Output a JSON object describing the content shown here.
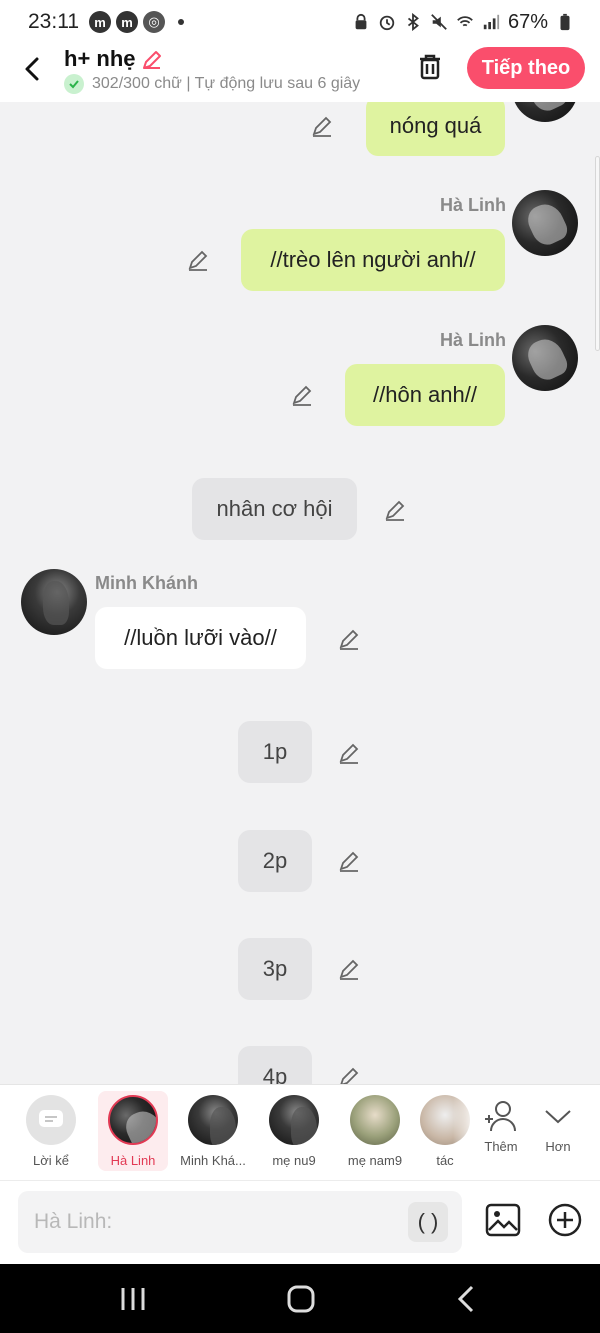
{
  "status": {
    "time": "23:11",
    "battery": "67%"
  },
  "header": {
    "title": "h+ nhẹ",
    "subtitle": "302/300 chữ | Tự động lưu sau 6 giây",
    "next_label": "Tiếp theo"
  },
  "messages": [
    {
      "text": "nóng quá"
    },
    {
      "speaker": "Hà Linh",
      "text": "//trèo lên người anh//"
    },
    {
      "speaker": "Hà Linh",
      "text": "//hôn anh//"
    },
    {
      "text": "nhân cơ hội"
    },
    {
      "speaker": "Minh Khánh",
      "text": "//luồn lưỡi vào//"
    },
    {
      "text": "1p"
    },
    {
      "text": "2p"
    },
    {
      "text": "3p"
    },
    {
      "text": "4p"
    }
  ],
  "characters": [
    {
      "label": "Lời kể",
      "selected": false
    },
    {
      "label": "Hà Linh",
      "selected": true
    },
    {
      "label": "Minh Khá...",
      "selected": false
    },
    {
      "label": "mẹ nu9",
      "selected": false
    },
    {
      "label": "mẹ nam9",
      "selected": false
    },
    {
      "label": "tác",
      "selected": false
    }
  ],
  "toolbar": {
    "more_label": "Thêm",
    "expand_label": "Hơn"
  },
  "input": {
    "placeholder": "Hà Linh:",
    "paren_label": "( )"
  },
  "colors": {
    "accent": "#fa4e6c",
    "bubble_green": "#dff3a0",
    "selected_red": "#e23a54"
  }
}
